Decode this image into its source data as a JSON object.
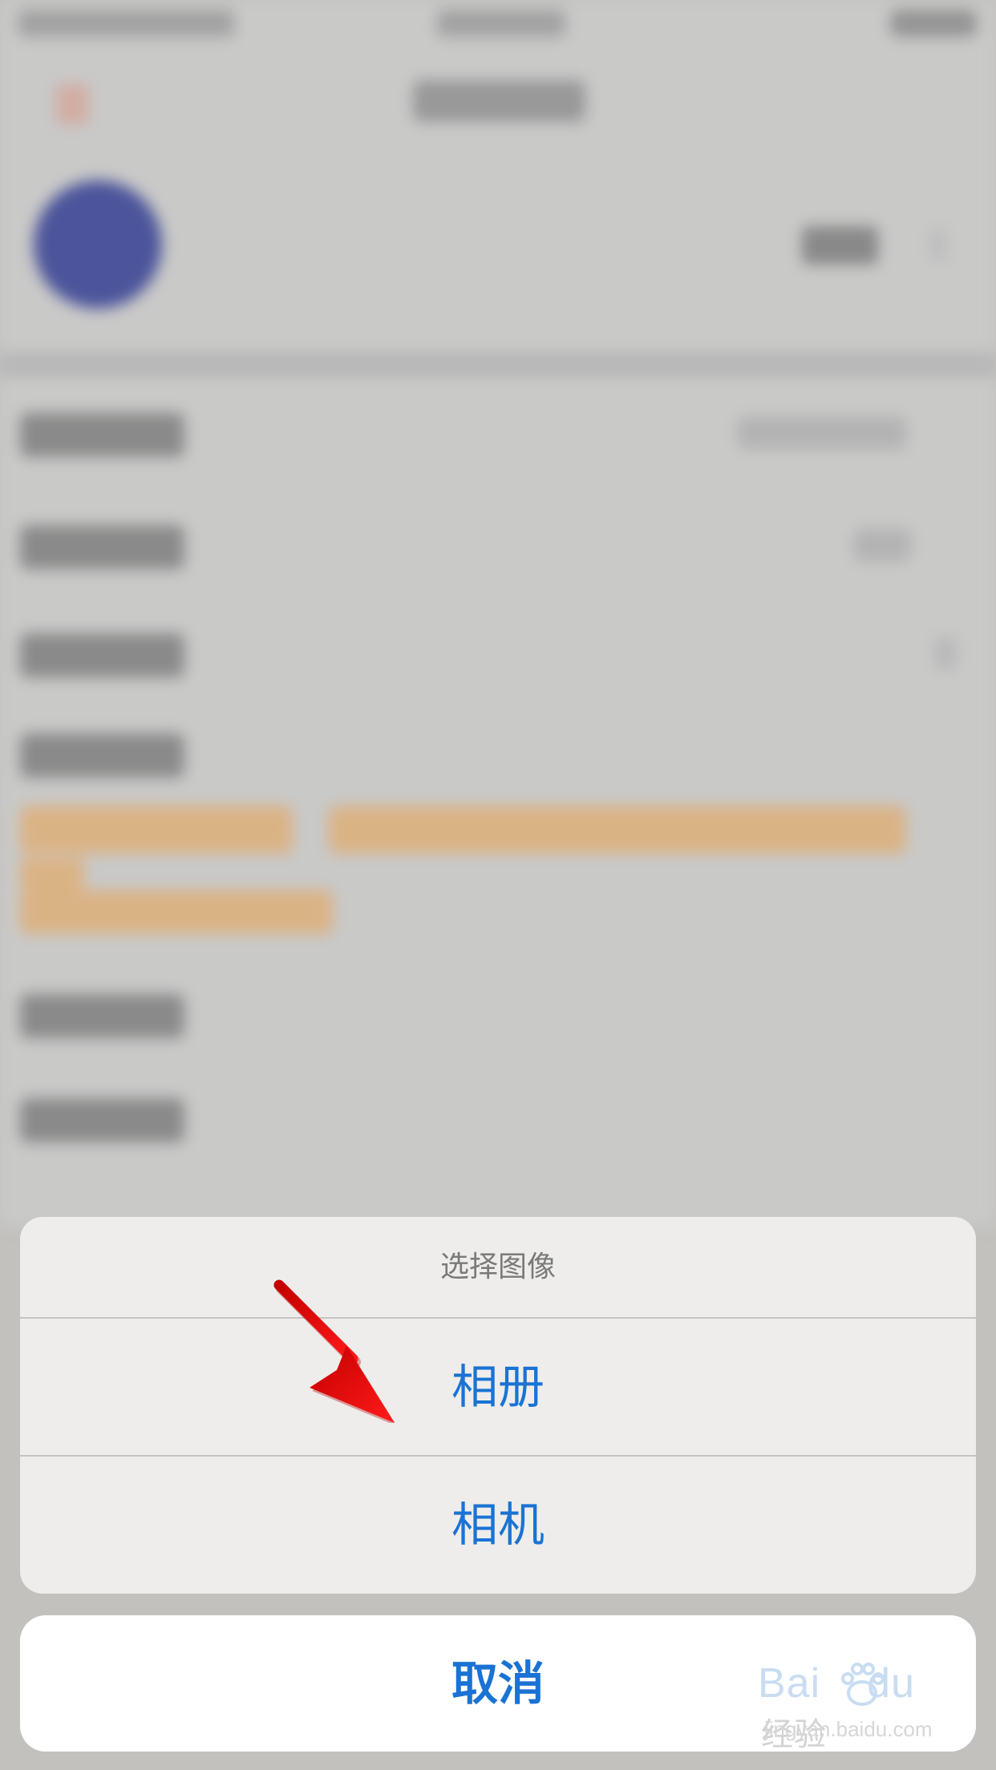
{
  "action_sheet": {
    "title": "选择图像",
    "options": [
      {
        "label": "相册"
      },
      {
        "label": "相机"
      }
    ],
    "cancel_label": "取消"
  },
  "watermark": {
    "logo_prefix": "Bai",
    "logo_suffix": "du",
    "logo_cn": "经验",
    "url": "jingyan.baidu.com"
  },
  "colors": {
    "accent": "#1a73d4",
    "annotation": "#e01b1b",
    "sheet_bg": "#efedeb",
    "avatar": "#4f58a1",
    "notice": "#e2b98a"
  },
  "icons": {
    "annotation": "red-arrow-icon",
    "watermark": "baidu-paw-icon"
  }
}
